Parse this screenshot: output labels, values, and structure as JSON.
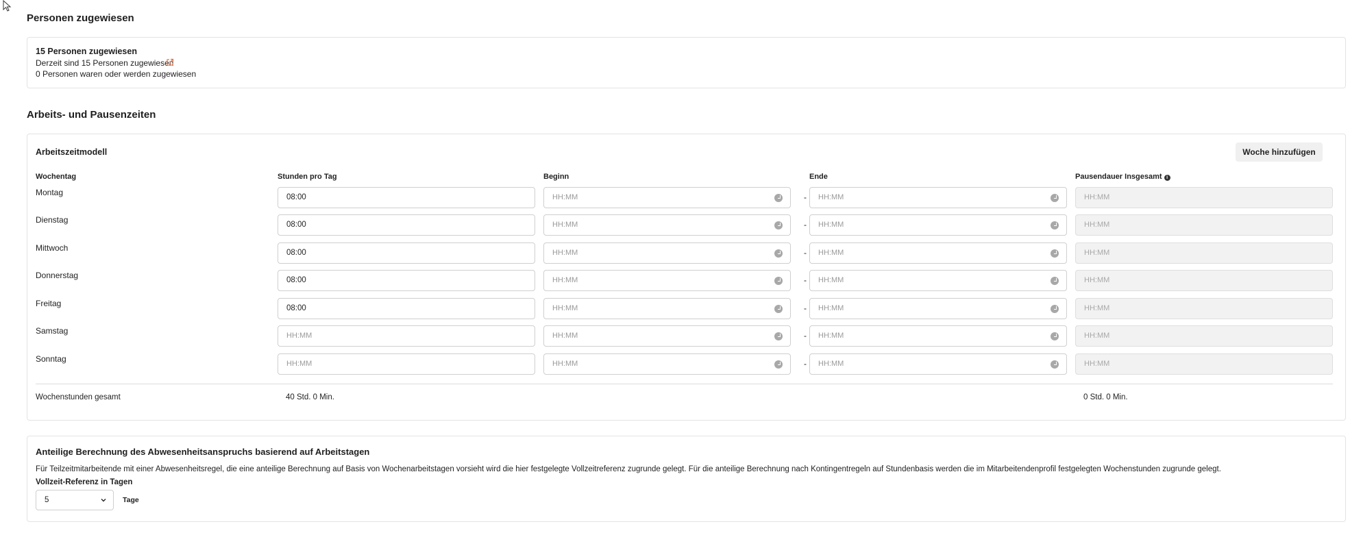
{
  "assigned_section": {
    "title": "Personen zugewiesen",
    "card_title": "15 Personen zugewiesen",
    "current_text": "Derzeit sind 15 Personen zugewiesen",
    "past_future_text": "0 Personen waren oder werden zugewiesen"
  },
  "work_section": {
    "title": "Arbeits- und Pausenzeiten",
    "model_title": "Arbeitszeitmodell",
    "add_week_label": "Woche hinzufügen",
    "columns": {
      "weekday": "Wochentag",
      "hours_per_day": "Stunden pro Tag",
      "begin": "Beginn",
      "end": "Ende",
      "break_total": "Pausendauer Insgesamt"
    },
    "time_placeholder": "HH:MM",
    "range_separator": "-",
    "days": [
      {
        "name": "Montag",
        "hours": "08:00"
      },
      {
        "name": "Dienstag",
        "hours": "08:00"
      },
      {
        "name": "Mittwoch",
        "hours": "08:00"
      },
      {
        "name": "Donnerstag",
        "hours": "08:00"
      },
      {
        "name": "Freitag",
        "hours": "08:00"
      },
      {
        "name": "Samstag",
        "hours": ""
      },
      {
        "name": "Sonntag",
        "hours": ""
      }
    ],
    "totals": {
      "label": "Wochenstunden gesamt",
      "hours": "40 Std. 0 Min.",
      "breaks": "0 Std. 0 Min."
    }
  },
  "absence_section": {
    "title": "Anteilige Berechnung des Abwesenheitsanspruchs basierend auf Arbeitstagen",
    "description": "Für Teilzeitmitarbeitende mit einer Abwesenheitsregel, die eine anteilige Berechnung auf Basis von Wochenarbeitstagen vorsieht wird die hier festgelegte Vollzeitreferenz zugrunde gelegt. Für die anteilige Berechnung nach Kontingentregeln auf Stundenbasis werden die im Mitarbeitendenprofil festgelegten Wochenstunden zugrunde gelegt.",
    "field_label": "Vollzeit-Referenz in Tagen",
    "selected_value": "5",
    "unit": "Tage"
  },
  "colors": {
    "accent_link": "#e8734a",
    "border": "#e3e3e3",
    "disabled_bg": "#f2f2f2"
  }
}
